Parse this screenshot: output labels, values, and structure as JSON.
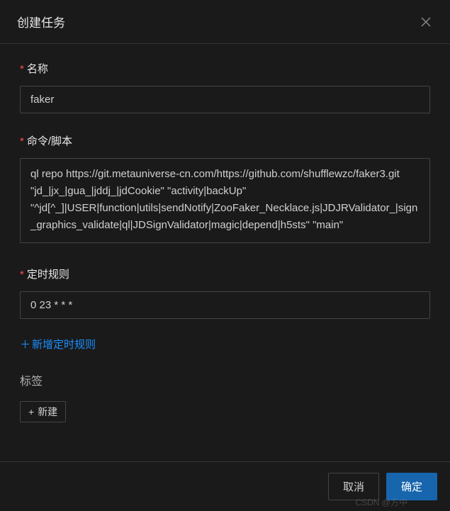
{
  "header": {
    "title": "创建任务"
  },
  "form": {
    "name": {
      "label": "名称",
      "value": "faker"
    },
    "command": {
      "label": "命令/脚本",
      "value": "ql repo https://git.metauniverse-cn.com/https://github.com/shufflewzc/faker3.git \"jd_|jx_|gua_|jddj_|jdCookie\" \"activity|backUp\" \"^jd[^_]|USER|function|utils|sendNotify|ZooFaker_Necklace.js|JDJRValidator_|sign_graphics_validate|ql|JDSignValidator|magic|depend|h5sts\" \"main\""
    },
    "schedule": {
      "label": "定时规则",
      "value": "0 23 * * *"
    },
    "add_schedule_link": "新增定时规则",
    "tags": {
      "label": "标签",
      "new_button": "新建"
    }
  },
  "footer": {
    "cancel": "取消",
    "confirm": "确定"
  },
  "watermark": "CSDN @方中"
}
